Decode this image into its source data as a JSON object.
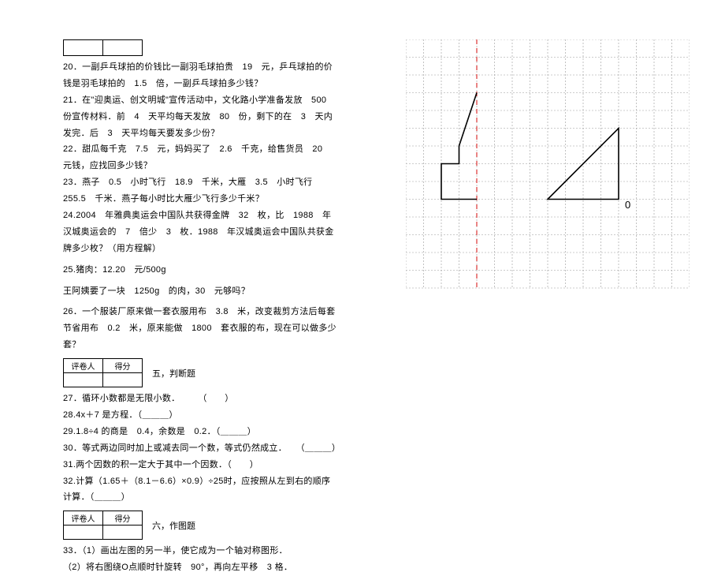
{
  "q20": "20．一副乒乓球拍的价钱比一副羽毛球拍贵　19　元，乒乓球拍的价钱是羽毛球拍的　1.5　倍，一副乒乓球拍多少钱？",
  "q21": "21．在\"迎奥运、创文明城\"宣传活动中，文化路小学准备发放　500　份宣传材料．前　4　天平均每天发放　80　份，剩下的在　3　天内发完．后　3　天平均每天要发多少份？",
  "q22": "22．甜瓜每千克　7.5　元，妈妈买了　2.6　千克，给售货员　20　元钱，应找回多少钱？",
  "q23": "23．燕子　0.5　小时飞行　18.9　千米，大雁　3.5　小时飞行　255.5　千米．燕子每小时比大雁少飞行多少千米？",
  "q24": "24.2004　年雅典奥运会中国队共获得金牌　32　枚，比　1988　年汉城奥运会的　7　倍少　3　枚．1988　年汉城奥运会中国队共获金牌多少枚？（用方程解）",
  "q25a": "25.猪肉：12.20　元/500g",
  "q25b": "王阿姨要了一块　1250g　的肉，30　元够吗？",
  "q26": "26．一个服装厂原来做一套衣服用布　3.8　米，改变裁剪方法后每套节省用布　0.2　米，原来能做　1800　套衣服的布，现在可以做多少套？",
  "score_label_a": "评卷人",
  "score_label_b": "得分",
  "section5": "五，判断题",
  "q27": "27．循环小数都是无限小数．　　　（　　）",
  "q28": "28.4x＋7 是方程．（＿＿＿）",
  "q29": "29.1.8÷4 的商是　0.4，余数是　0.2．（＿＿＿）",
  "q30": "30．等式两边同时加上或减去同一个数，等式仍然成立．　　（＿＿＿）",
  "q31": "31.两个因数的积一定大于其中一个因数．（　　）",
  "q32": "32.计算（1.65＋（8.1－6.6）×0.9）÷25时，应按照从左到右的顺序计算．（＿＿＿）",
  "section6": "六，作图题",
  "q33a": "33．（1）画出左图的另一半，使它成为一个轴对称图形．",
  "q33b": "（2）将右图绕O点顺时针旋转　90°，再向左平移　3 格．",
  "zero_label": "0",
  "chart_data": {
    "type": "diagram",
    "description": "A grid paper with two shapes: a staircase-like polyline on the left near a vertical red dashed axis of symmetry, and a right triangle on the right with point O marked at the bottom-right vertex.",
    "grid": {
      "cols": 16,
      "rows": 14
    },
    "axis_of_symmetry_col": 4,
    "left_shape_points": [
      [
        4,
        3
      ],
      [
        4,
        9
      ],
      [
        2,
        9
      ],
      [
        2,
        7
      ],
      [
        3,
        7
      ],
      [
        3,
        6
      ]
    ],
    "right_triangle_points": [
      [
        12,
        9
      ],
      [
        12,
        5
      ],
      [
        8,
        9
      ]
    ],
    "o_point": [
      12,
      9
    ]
  }
}
